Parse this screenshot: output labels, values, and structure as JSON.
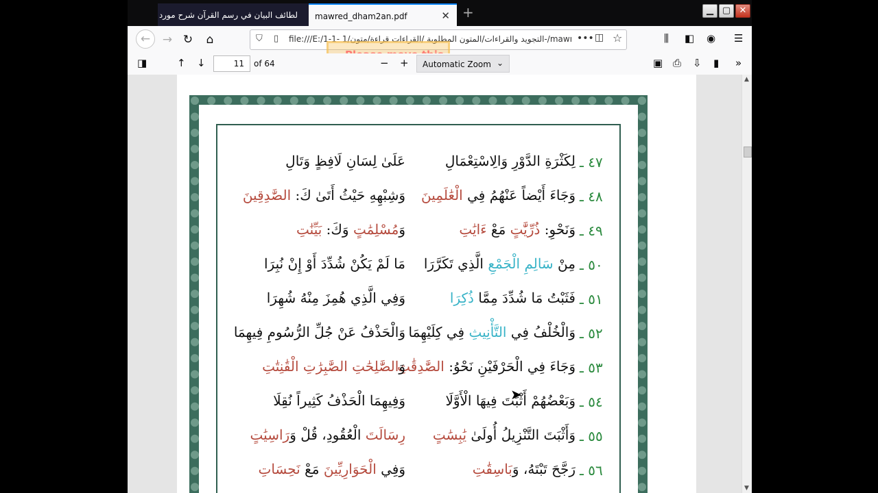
{
  "tabs": [
    {
      "title": "لطائف البيان في رسم القرآن شرح مورد ا"
    },
    {
      "title": "mawred_dham2an.pdf"
    }
  ],
  "window_buttons": {
    "minimize": "▁",
    "maximize": "▢",
    "close": "✕"
  },
  "nav": {
    "url": "file:///E:/1-1- التجويد والقراءات/المتون المطلوبة /القراءات قراءة/متون/1-/mawred_dh",
    "overlay_text": "Please move this"
  },
  "pdf_toolbar": {
    "page_number": "11",
    "page_count": "of 64",
    "zoom": "Automatic Zoom"
  },
  "verses": [
    {
      "num": "٤٧ ـ",
      "h1": [
        {
          "t": "لِكَثْرَةِ الدَّوْرِ وَالِاسْتِعْمَالِ",
          "c": ""
        }
      ],
      "h2": [
        {
          "t": "عَلَىٰ لِسَانِ لَافِظٍ وَتَالِ",
          "c": ""
        }
      ]
    },
    {
      "num": "٤٨ ـ",
      "h1": [
        {
          "t": "وَجَاءَ أَيْضاً عَنْهُمُ فِي ",
          "c": ""
        },
        {
          "t": "الْعَٰلَمِينَ",
          "c": "red"
        }
      ],
      "h2": [
        {
          "t": "وَشِبْهِهِ حَيْثُ أَتَىٰ كَ: ",
          "c": ""
        },
        {
          "t": "الصَّٰدِقِينَ",
          "c": "red"
        }
      ]
    },
    {
      "num": "٤٩ ـ",
      "h1": [
        {
          "t": "وَنَحْوِ: ",
          "c": ""
        },
        {
          "t": "ذُرِّيَّٰتٍ",
          "c": "red"
        },
        {
          "t": " مَعْ ",
          "c": ""
        },
        {
          "t": "ءَايَٰتِ",
          "c": "red"
        }
      ],
      "h2": [
        {
          "t": "وَ",
          "c": ""
        },
        {
          "t": "مُسْلِمَٰتٍ",
          "c": "red"
        },
        {
          "t": " وَكَ: ",
          "c": ""
        },
        {
          "t": "بَيِّنَٰتِ",
          "c": "red"
        }
      ]
    },
    {
      "num": "٥٠ ـ",
      "h1": [
        {
          "t": "مِنْ ",
          "c": ""
        },
        {
          "t": "سَالِمِ الْجَمْعِ",
          "c": "teal"
        },
        {
          "t": " الَّذِي تَكَرَّرَا",
          "c": ""
        }
      ],
      "h2": [
        {
          "t": "مَا لَمْ يَكُنْ شُدِّدَ أَوْ إِنْ نُبِرَا",
          "c": ""
        }
      ]
    },
    {
      "num": "٥١ ـ",
      "h1": [
        {
          "t": "فَثَبْتُ مَا شُدِّدَ مِمَّا ",
          "c": ""
        },
        {
          "t": "ذُكِرَا",
          "c": "teal"
        }
      ],
      "h2": [
        {
          "t": "وَفِي الَّذِي هُمِزَ مِنْهُ شُهِرَا",
          "c": ""
        }
      ]
    },
    {
      "num": "٥٢ ـ",
      "h1": [
        {
          "t": "وَالْخُلْفُ فِي ",
          "c": ""
        },
        {
          "t": "التَّأْنِيثِ",
          "c": "teal"
        },
        {
          "t": " فِي كِلَيْهِمَا",
          "c": ""
        }
      ],
      "h2": [
        {
          "t": "وَالْحَذْفُ عَنْ جُلِّ الرُّسُومِ فِيهِمَا",
          "c": ""
        }
      ]
    },
    {
      "num": "٥٣ ـ",
      "h1": [
        {
          "t": "وَجَاءَ فِي الْحَرْفَيْنِ نَحْوُ: ",
          "c": ""
        },
        {
          "t": "الصَّٰدِقَٰتِ",
          "c": "red"
        }
      ],
      "h2": [
        {
          "t": "وَ",
          "c": ""
        },
        {
          "t": "الصَّٰلِحَٰتِ الصَّٰبِرَٰتِ الْقَٰنِتَٰتِ",
          "c": "red"
        }
      ]
    },
    {
      "num": "٥٤ ـ",
      "h1": [
        {
          "t": "وَبَعْضُهُمْ أَثْبَتَ فِيهَا الْأَوَّلَا",
          "c": ""
        }
      ],
      "h2": [
        {
          "t": "وَفِيهِمَا الْحَذْفُ كَثِيراً نُقِلَا",
          "c": ""
        }
      ]
    },
    {
      "num": "٥٥ ـ",
      "h1": [
        {
          "t": "وَأَثْبَتَ التَّنْزِيلُ أُولَىٰ ",
          "c": ""
        },
        {
          "t": "يَٰبِسَٰتٍ",
          "c": "red"
        }
      ],
      "h2": [
        {
          "t": "رِسَالَتَ",
          "c": "red"
        },
        {
          "t": " الْعُقُودِ، قُلْ وَ",
          "c": ""
        },
        {
          "t": "رَاسِيَٰتٍ",
          "c": "red"
        }
      ]
    },
    {
      "num": "٥٦ ـ",
      "h1": [
        {
          "t": "رَجَّحَ تَبْتَهُ، وَ",
          "c": ""
        },
        {
          "t": "بَاسِقَٰتِ",
          "c": "red"
        }
      ],
      "h2": [
        {
          "t": "وَفِي ",
          "c": ""
        },
        {
          "t": "الْحَوَارِيِّينَ",
          "c": "red"
        },
        {
          "t": " مَعْ ",
          "c": ""
        },
        {
          "t": "نَحِسَاتِ",
          "c": "red"
        }
      ]
    }
  ]
}
